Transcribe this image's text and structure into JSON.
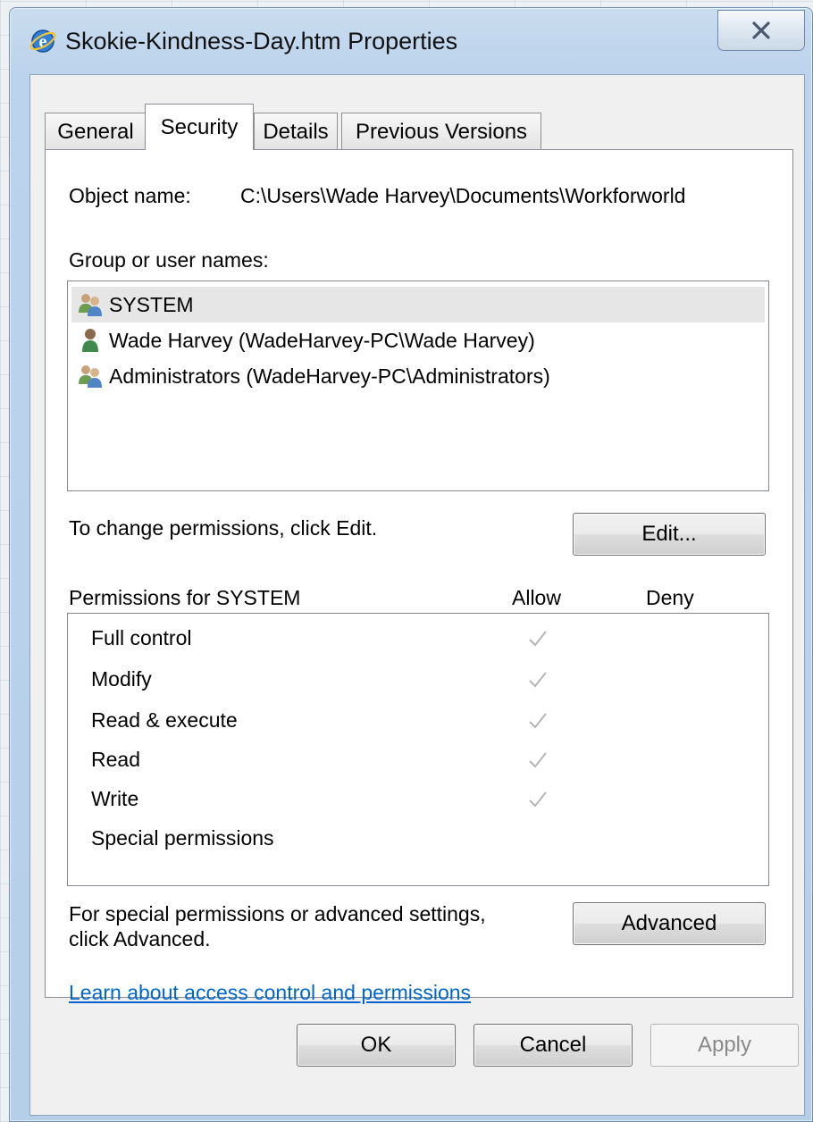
{
  "window": {
    "title": "Skokie-Kindness-Day.htm Properties",
    "close_glyph": "X"
  },
  "tabs": [
    {
      "label": "General",
      "active": false
    },
    {
      "label": "Security",
      "active": true
    },
    {
      "label": "Details",
      "active": false
    },
    {
      "label": "Previous Versions",
      "active": false
    }
  ],
  "security": {
    "object_name_label": "Object name:",
    "object_name_value": "C:\\Users\\Wade Harvey\\Documents\\Workforworld",
    "group_label": "Group or user names:",
    "users": [
      {
        "name": "SYSTEM",
        "icon": "group-users-icon",
        "selected": true
      },
      {
        "name": "Wade Harvey (WadeHarvey-PC\\Wade Harvey)",
        "icon": "single-user-icon",
        "selected": false
      },
      {
        "name": "Administrators (WadeHarvey-PC\\Administrators)",
        "icon": "group-users-icon",
        "selected": false
      }
    ],
    "change_hint": "To change permissions, click Edit.",
    "edit_button": "Edit...",
    "permissions_header": "Permissions for SYSTEM",
    "allow_header": "Allow",
    "deny_header": "Deny",
    "permissions": [
      {
        "name": "Full control",
        "allow": true,
        "deny": false
      },
      {
        "name": "Modify",
        "allow": true,
        "deny": false
      },
      {
        "name": "Read & execute",
        "allow": true,
        "deny": false
      },
      {
        "name": "Read",
        "allow": true,
        "deny": false
      },
      {
        "name": "Write",
        "allow": true,
        "deny": false
      },
      {
        "name": "Special permissions",
        "allow": false,
        "deny": false
      }
    ],
    "advanced_hint_line1": "For special permissions or advanced settings,",
    "advanced_hint_line2": "click Advanced.",
    "advanced_button": "Advanced",
    "learn_link": "Learn about access control and permissions"
  },
  "footer": {
    "ok": "OK",
    "cancel": "Cancel",
    "apply": "Apply"
  },
  "colors": {
    "link": "#0066cc",
    "check": "#b5b5b5",
    "selection": "#e6e6e6"
  }
}
